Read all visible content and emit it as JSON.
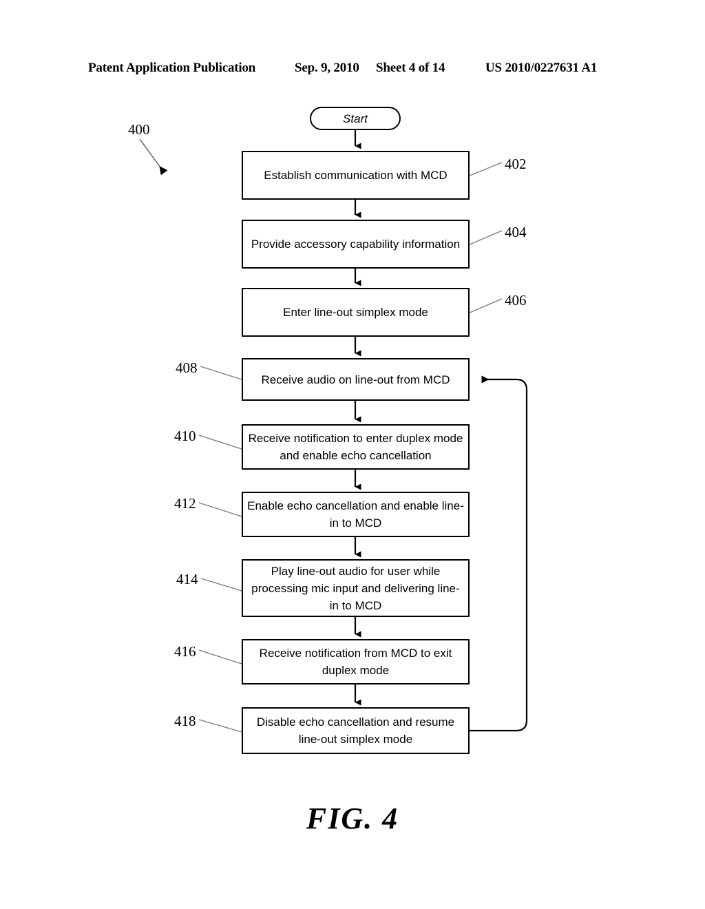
{
  "header": {
    "publication": "Patent Application Publication",
    "date": "Sep. 9, 2010",
    "sheet": "Sheet 4 of 14",
    "patent_number": "US 2010/0227631 A1"
  },
  "figure": {
    "caption": "FIG. 4",
    "diagram_label": "400"
  },
  "flowchart": {
    "start_label": "Start",
    "nodes": [
      {
        "ref": "402",
        "text": "Establish communication with MCD",
        "ref_side": "right"
      },
      {
        "ref": "404",
        "text": "Provide accessory capability information",
        "ref_side": "right"
      },
      {
        "ref": "406",
        "text": "Enter line-out simplex mode",
        "ref_side": "right"
      },
      {
        "ref": "408",
        "text": "Receive audio on line-out from MCD",
        "ref_side": "left"
      },
      {
        "ref": "410",
        "text": "Receive notification to enter duplex mode and enable echo cancellation",
        "ref_side": "left"
      },
      {
        "ref": "412",
        "text": "Enable echo cancellation and enable line-in to MCD",
        "ref_side": "left"
      },
      {
        "ref": "414",
        "text": "Play line-out audio for user while processing mic input and delivering line-in to MCD",
        "ref_side": "left"
      },
      {
        "ref": "416",
        "text": "Receive notification from MCD to exit duplex mode",
        "ref_side": "left"
      },
      {
        "ref": "418",
        "text": "Disable echo cancellation and resume line-out simplex mode",
        "ref_side": "left"
      }
    ],
    "feedback_loop": {
      "from_ref": "418",
      "to_ref": "408"
    }
  },
  "colors": {
    "ink": "#000000",
    "paper": "#ffffff",
    "leader_line": "#808080"
  }
}
